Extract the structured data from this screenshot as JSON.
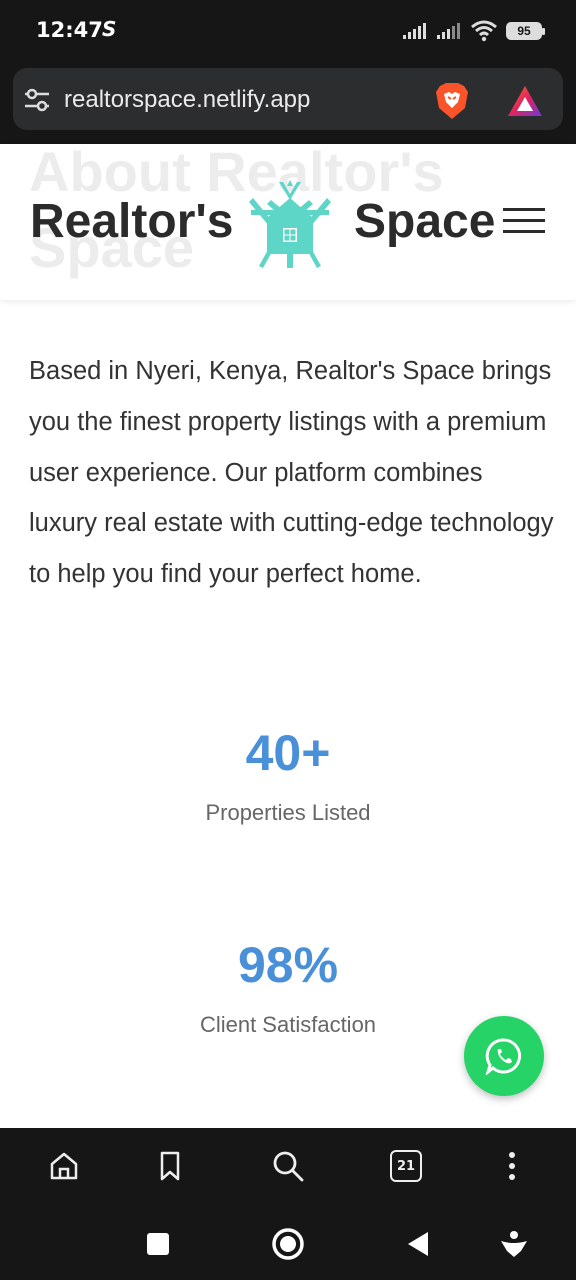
{
  "status_bar": {
    "time": "12:47",
    "app_icon": "S",
    "battery": "95",
    "icons": [
      "signal-icon",
      "signal-icon",
      "wifi-icon",
      "battery-icon"
    ]
  },
  "browser": {
    "url": "realtorspace.netlify.app",
    "tabs_count": "21",
    "toolbar_icons": [
      "home-icon",
      "bookmark-icon",
      "search-icon",
      "tabs-icon",
      "more-icon"
    ]
  },
  "header": {
    "bg_title": "About Realtor's Space",
    "brand_left": "Realtor's",
    "brand_right": "Space",
    "logo_color": "#5dd6c8"
  },
  "about": {
    "text": "Based in Nyeri, Kenya, Realtor's Space brings you the finest property listings with a premium user experience. Our platform combines luxury real estate with cutting-edge technology to help you find your perfect home."
  },
  "stats": [
    {
      "value": "40+",
      "label": "Properties Listed"
    },
    {
      "value": "98%",
      "label": "Client Satisfaction"
    }
  ],
  "colors": {
    "accent": "#4a90d9",
    "whatsapp": "#25d366",
    "system_bar": "#161616"
  }
}
